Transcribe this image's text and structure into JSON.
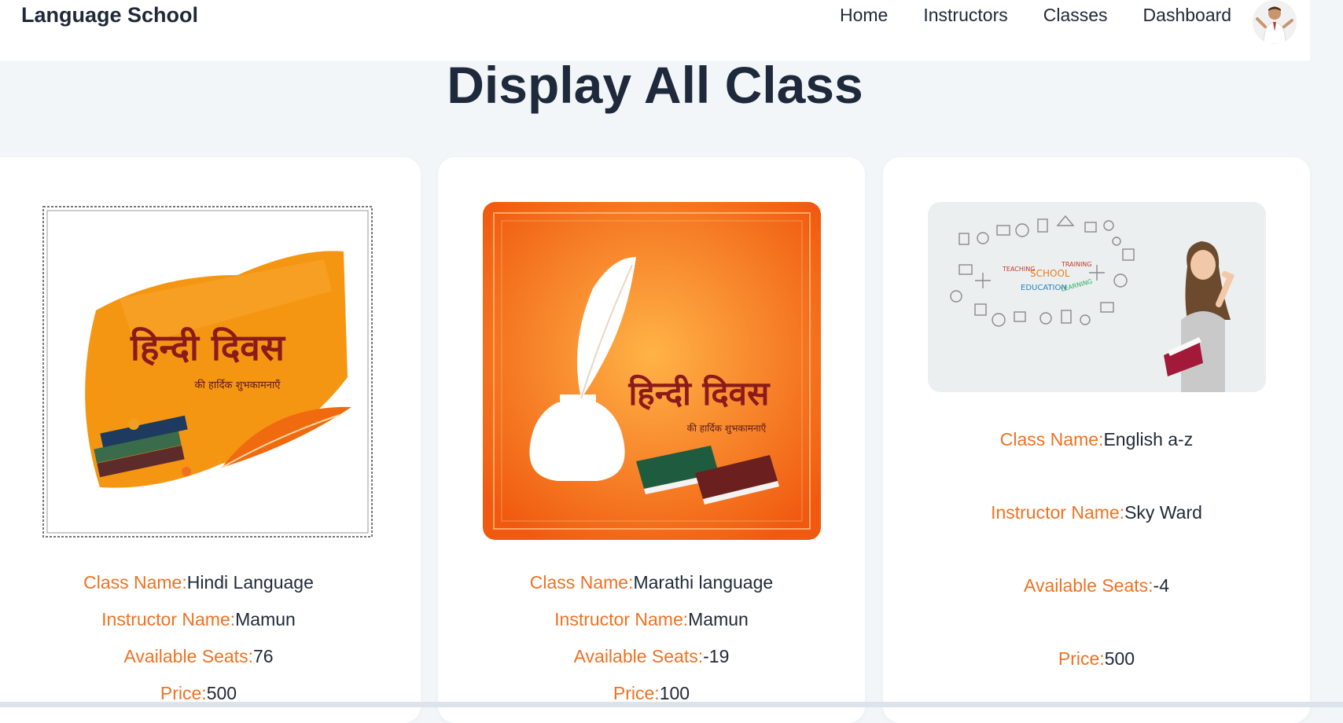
{
  "app": {
    "brand": "Language School"
  },
  "nav": {
    "items": [
      {
        "label": "Home"
      },
      {
        "label": "Instructors"
      },
      {
        "label": "Classes"
      },
      {
        "label": "Dashboard"
      }
    ]
  },
  "page": {
    "title": "Display All Class"
  },
  "labels": {
    "class_name": "Class Name:",
    "instructor_name": "Instructor Name:",
    "available_seats": "Available Seats:",
    "price": "Price:"
  },
  "classes": [
    {
      "class_name": "Hindi Language",
      "instructor": "Mamun",
      "seats": "76",
      "price": "500",
      "image_text": {
        "title": "हिन्दी दिवस",
        "subtitle": "की हार्दिक शुभकामनाएँ"
      }
    },
    {
      "class_name": "Marathi language",
      "instructor": "Mamun",
      "seats": "-19",
      "price": "100",
      "image_text": {
        "title": "हिन्दी दिवस",
        "subtitle": "की हार्दिक शुभकामनाएँ"
      }
    },
    {
      "class_name": "English a-z",
      "instructor": "Sky Ward",
      "seats": "-4",
      "price": "500",
      "image_text": {
        "w1": "TEACHING",
        "w2": "SCHOOL",
        "w3": "TRAINING",
        "w4": "EDUCATION",
        "w5": "LEARNING"
      }
    }
  ],
  "colors": {
    "accent": "#f07122",
    "title": "#1e293b",
    "background": "#f3f6f9"
  }
}
